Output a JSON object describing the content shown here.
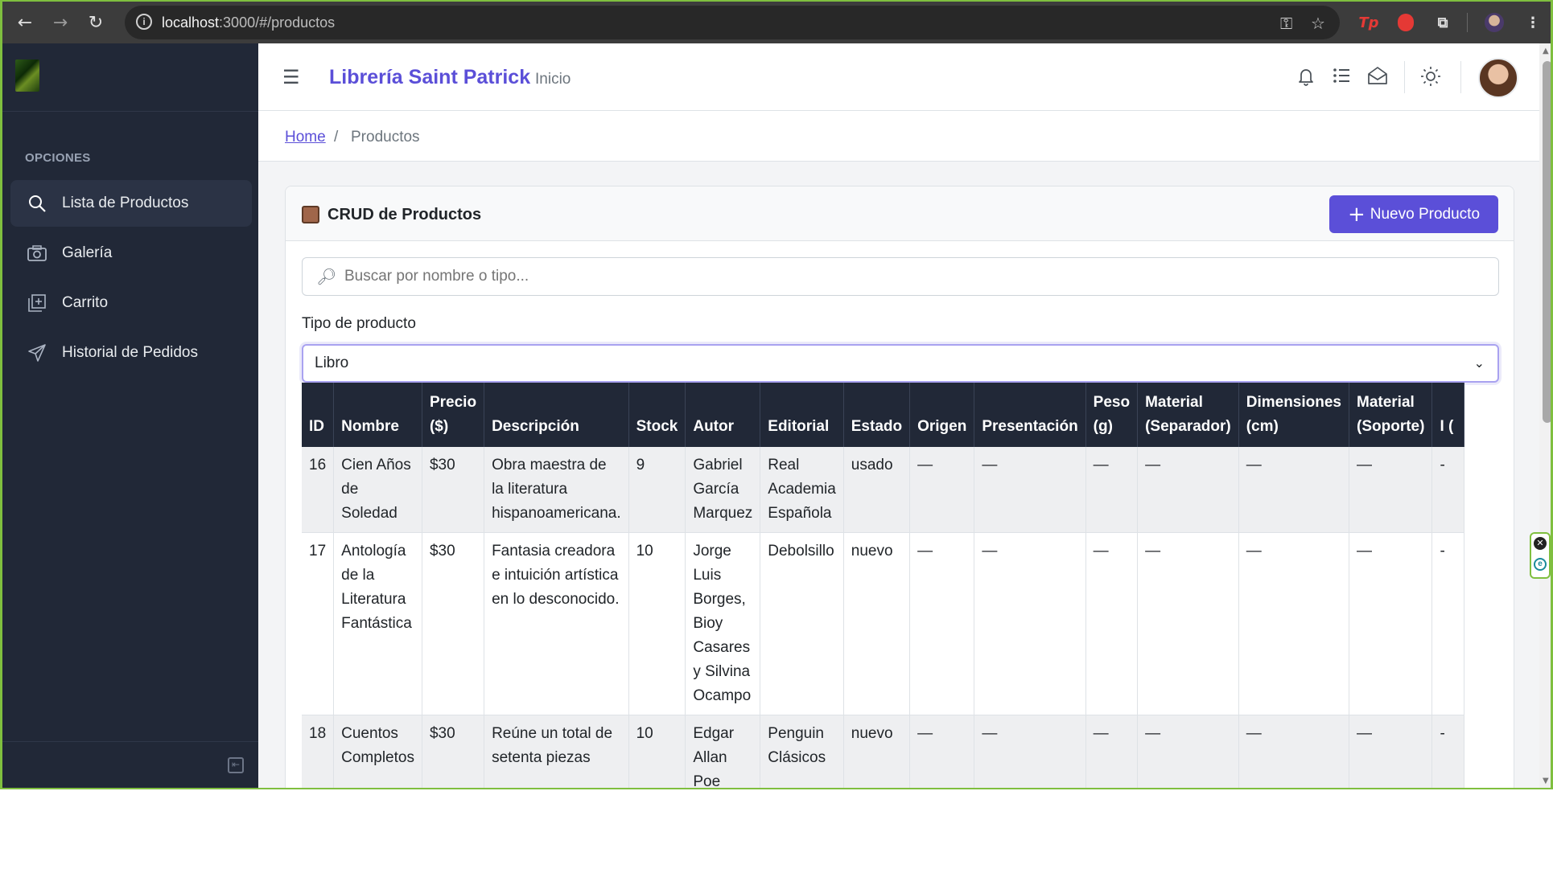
{
  "browser": {
    "url_host": "localhost",
    "url_rest": ":3000/#/productos",
    "back_icon": "←",
    "forward_icon": "→",
    "reload_icon": "↻",
    "ext_tp": "Tp"
  },
  "sidebar": {
    "section_title": "OPCIONES",
    "items": [
      {
        "label": "Lista de Productos",
        "icon": "search-icon"
      },
      {
        "label": "Galería",
        "icon": "camera-icon"
      },
      {
        "label": "Carrito",
        "icon": "cart-add-icon"
      },
      {
        "label": "Historial de Pedidos",
        "icon": "send-icon"
      }
    ]
  },
  "header": {
    "brand": "Librería Saint Patrick",
    "home_link": "Inicio"
  },
  "breadcrumb": {
    "home": "Home",
    "separator": "/",
    "current": "Productos"
  },
  "card": {
    "title": "CRUD de Productos",
    "new_button": "Nuevo Producto",
    "search_placeholder": "Buscar por nombre o tipo...",
    "type_label": "Tipo de producto",
    "type_value": "Libro"
  },
  "table": {
    "columns": [
      "ID",
      "Nombre",
      "Precio ($)",
      "Descripción",
      "Stock",
      "Autor",
      "Editorial",
      "Estado",
      "Origen",
      "Presentación",
      "Peso (g)",
      "Material (Separador)",
      "Dimensiones (cm)",
      "Material (Soporte)",
      "I ("
    ],
    "rows": [
      [
        "16",
        "Cien Años de Soledad",
        "$30",
        "Obra maestra de la literatura hispanoamericana.",
        "9",
        "Gabriel García Marquez",
        "Real Academia Española",
        "usado",
        "—",
        "—",
        "—",
        "—",
        "—",
        "—",
        "-"
      ],
      [
        "17",
        "Antología de la Literatura Fantástica",
        "$30",
        "Fantasia creadora e intuición artística en lo desconocido.",
        "10",
        "Jorge Luis Borges, Bioy Casares y Silvina Ocampo",
        "Debolsillo",
        "nuevo",
        "—",
        "—",
        "—",
        "—",
        "—",
        "—",
        "-"
      ],
      [
        "18",
        "Cuentos Completos",
        "$30",
        "Reúne un total de setenta piezas",
        "10",
        "Edgar Allan Poe",
        "Penguin Clásicos",
        "nuevo",
        "—",
        "—",
        "—",
        "—",
        "—",
        "—",
        "-"
      ]
    ]
  },
  "colors": {
    "accent": "#5b4fd8",
    "sidebar_bg": "#212837",
    "table_head_bg": "#212837"
  }
}
